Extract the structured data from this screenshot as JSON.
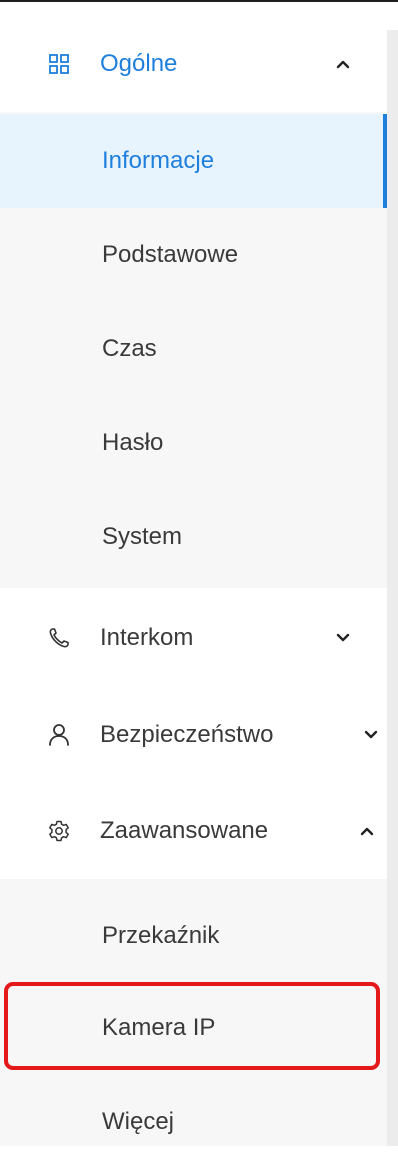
{
  "sidebar": {
    "groups": [
      {
        "label": "Ogólne",
        "icon": "grid-icon",
        "expanded": true,
        "items": [
          {
            "label": "Informacje",
            "selected": true
          },
          {
            "label": "Podstawowe"
          },
          {
            "label": "Czas"
          },
          {
            "label": "Hasło"
          },
          {
            "label": "System"
          }
        ]
      },
      {
        "label": "Interkom",
        "icon": "phone-icon",
        "expanded": false
      },
      {
        "label": "Bezpieczeństwo",
        "icon": "user-icon",
        "expanded": false
      },
      {
        "label": "Zaawansowane",
        "icon": "gear-icon",
        "expanded": true,
        "items": [
          {
            "label": "Przekaźnik"
          },
          {
            "label": "Kamera IP",
            "highlighted": true
          },
          {
            "label": "Więcej"
          }
        ]
      }
    ]
  },
  "colors": {
    "accent": "#1e7fdc",
    "selected_bg": "#e7f3fd",
    "submenu_bg": "#f7f7f7",
    "text": "#3a3a3a",
    "highlight_border": "#e3191b"
  }
}
